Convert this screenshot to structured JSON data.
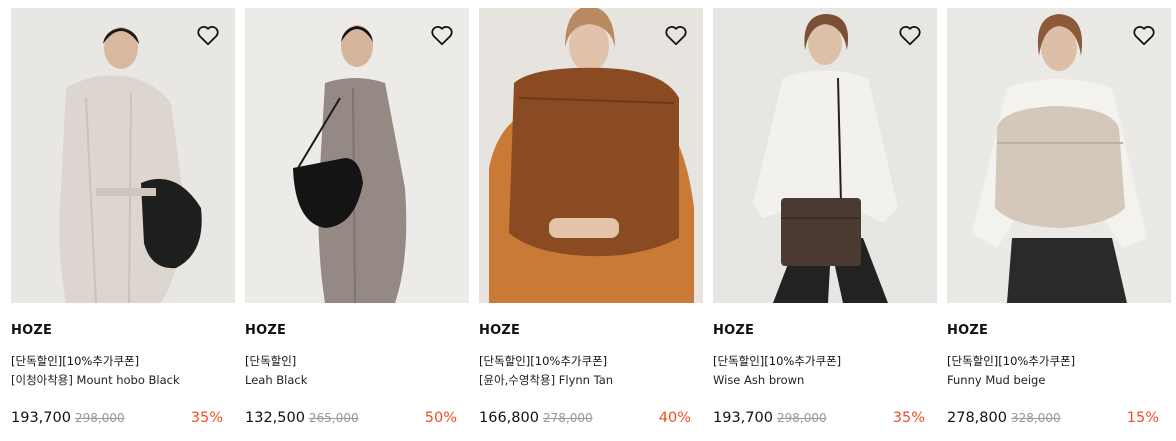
{
  "products": [
    {
      "brand": "HOZE",
      "promo": "[단독할인][10%추가쿠폰]",
      "title": "[이청아착용] Mount hobo Black",
      "price": "193,700",
      "original_price": "298,000",
      "discount": "35%"
    },
    {
      "brand": "HOZE",
      "promo": "[단독할인]",
      "title": "Leah Black",
      "price": "132,500",
      "original_price": "265,000",
      "discount": "50%"
    },
    {
      "brand": "HOZE",
      "promo": "[단독할인][10%추가쿠폰]",
      "title": "[윤아,수영착용] Flynn Tan",
      "price": "166,800",
      "original_price": "278,000",
      "discount": "40%"
    },
    {
      "brand": "HOZE",
      "promo": "[단독할인][10%추가쿠폰]",
      "title": "Wise Ash brown",
      "price": "193,700",
      "original_price": "298,000",
      "discount": "35%"
    },
    {
      "brand": "HOZE",
      "promo": "[단독할인][10%추가쿠폰]",
      "title": "Funny Mud beige",
      "price": "278,800",
      "original_price": "328,000",
      "discount": "15%"
    }
  ],
  "icons": {
    "wishlist": "heart-outline-icon"
  },
  "colors": {
    "discount": "#f04e23",
    "original_price": "#999999"
  }
}
